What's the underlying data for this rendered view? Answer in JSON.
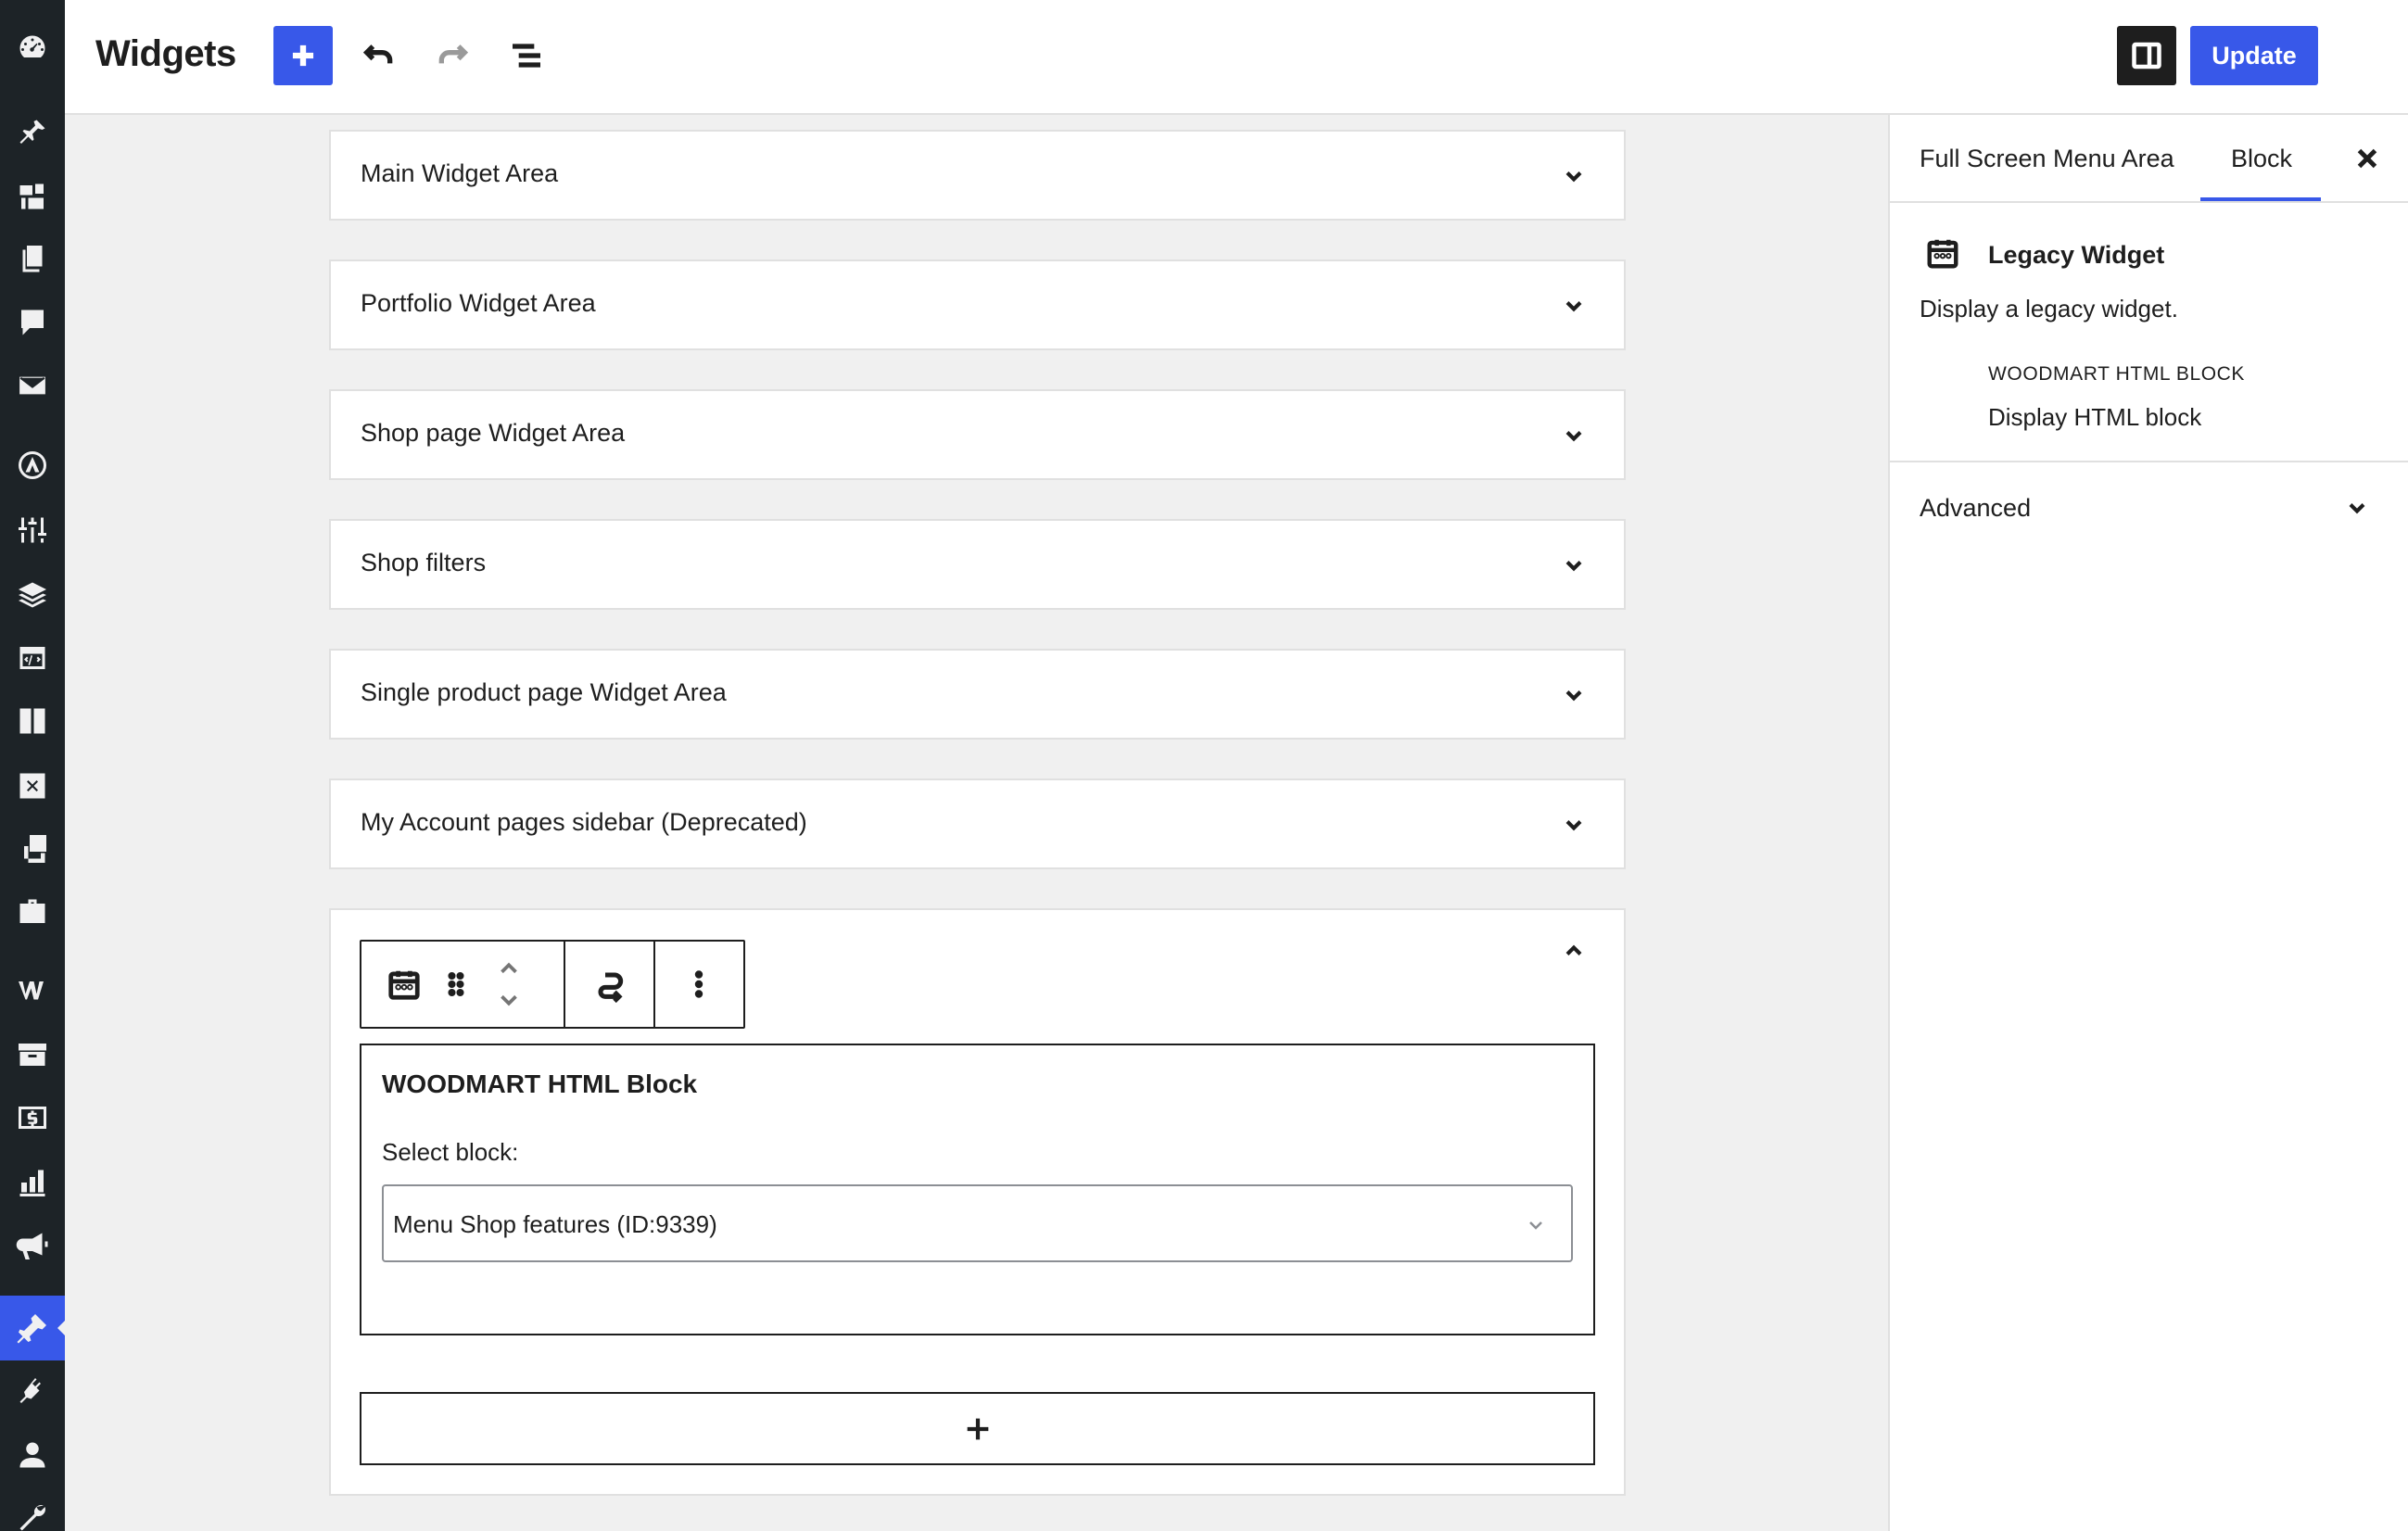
{
  "header": {
    "title": "Widgets",
    "update_label": "Update"
  },
  "admin_menu": [
    "dashboard-icon",
    "pin-icon",
    "media-icon",
    "pages-icon",
    "comments-icon",
    "mail-icon",
    "elementor-icon",
    "sliders-icon",
    "layers-icon",
    "code-icon",
    "book-icon",
    "close-box-icon",
    "gallery-icon",
    "briefcase-icon",
    "woocommerce-icon",
    "archive-icon",
    "dollar-icon",
    "chart-icon",
    "megaphone-icon",
    "appearance-icon",
    "plugins-icon",
    "users-icon",
    "tools-icon"
  ],
  "widget_areas": [
    {
      "title": "Main Widget Area"
    },
    {
      "title": "Portfolio Widget Area"
    },
    {
      "title": "Shop page Widget Area"
    },
    {
      "title": "Shop filters"
    },
    {
      "title": "Single product page Widget Area"
    },
    {
      "title": "My Account pages sidebar (Deprecated)"
    }
  ],
  "open_widget": {
    "title": "WOODMART HTML Block",
    "select_label": "Select block:",
    "select_value": "Menu Shop features (ID:9339)"
  },
  "sidebar": {
    "tabs": [
      "Full Screen Menu Area",
      "Block"
    ],
    "active_tab": "Block",
    "card_title": "Legacy Widget",
    "card_desc": "Display a legacy widget.",
    "sub_title": "WOODMART HTML BLOCK",
    "sub_desc": "Display HTML block",
    "advanced_label": "Advanced"
  },
  "colors": {
    "accent": "#3858e9",
    "admin_bg": "#1d2327",
    "canvas_bg": "#f0f0f0"
  }
}
